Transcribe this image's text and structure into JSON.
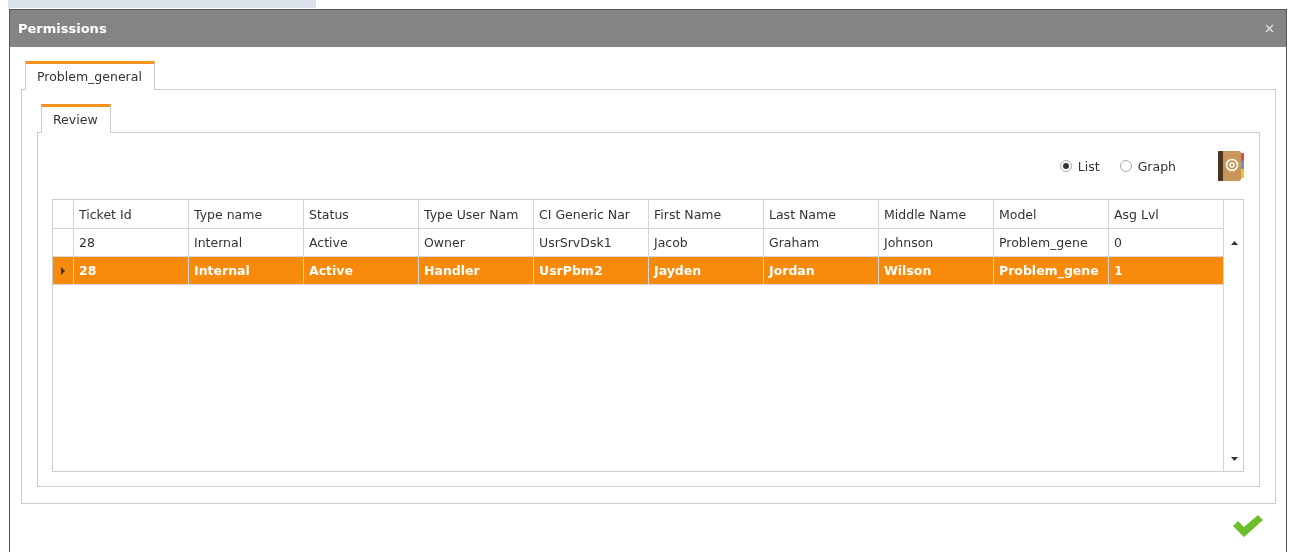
{
  "window": {
    "title": "Permissions"
  },
  "outer_tabs": [
    {
      "label": "Problem_general",
      "selected": true
    }
  ],
  "inner_tabs": [
    {
      "label": "Review",
      "selected": true
    }
  ],
  "view_options": [
    {
      "label": "List",
      "selected": true
    },
    {
      "label": "Graph",
      "selected": false
    }
  ],
  "table": {
    "columns": [
      "Ticket Id",
      "Type name",
      "Status",
      "Type User Nam",
      "CI Generic Nar",
      "First Name",
      "Last Name",
      "Middle Name",
      "Model",
      "Asg Lvl"
    ],
    "rows": [
      {
        "selected": false,
        "cells": [
          "28",
          "Internal",
          "Active",
          "Owner",
          "UsrSrvDsk1",
          "Jacob",
          "Graham",
          "Johnson",
          "Problem_gene",
          "0"
        ]
      },
      {
        "selected": true,
        "cells": [
          "28",
          "Internal",
          "Active",
          "Handler",
          "UsrPbm2",
          "Jayden",
          "Jordan",
          "Wilson",
          "Problem_gene",
          "1"
        ]
      }
    ]
  }
}
